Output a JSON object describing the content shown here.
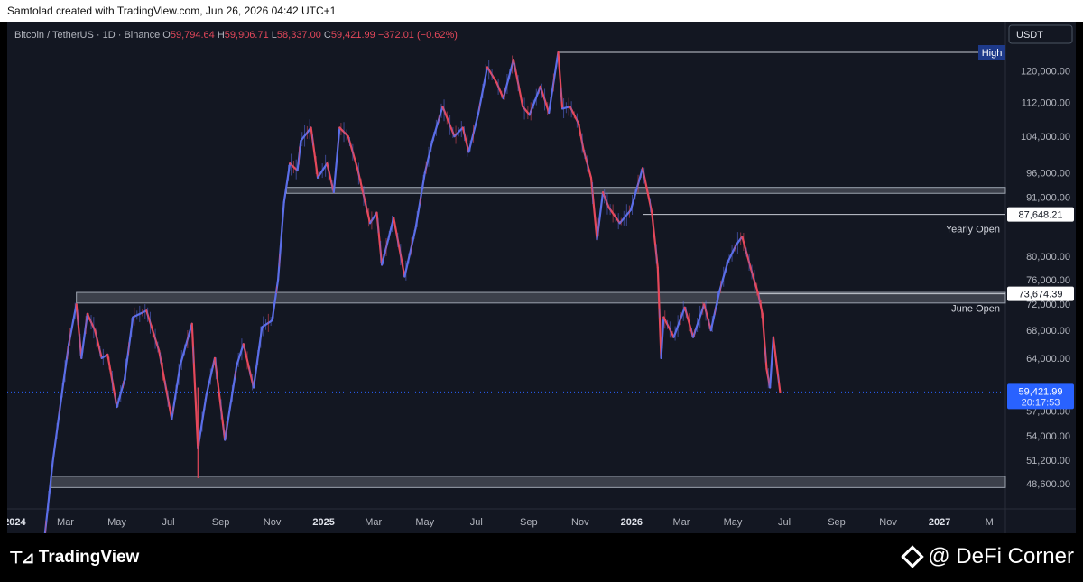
{
  "header": {
    "attribution": "Samtolad created with TradingView.com, Jun 26, 2026 04:42 UTC+1"
  },
  "legend": {
    "symbol": "Bitcoin / TetherUS · 1D · Binance",
    "o_label": "O",
    "o": "59,794.64",
    "h_label": "H",
    "h": "59,906.71",
    "l_label": "L",
    "l": "58,337.00",
    "c_label": "C",
    "c": "59,421.99",
    "change": "−372.01 (−0.62%)"
  },
  "currency": "USDT",
  "footer": {
    "logo": "TradingView",
    "credit": "@ DeFi Corner"
  },
  "colors": {
    "background": "#131722",
    "up": "#5b6ee8",
    "down": "#e5485b",
    "last_price": "#2962ff",
    "high_label": "#1e3a8a"
  },
  "chart_data": {
    "type": "line",
    "y_scale": "log",
    "ylim": [
      46000,
      128000
    ],
    "x_range": [
      "2023-12-23",
      "2027-03-20"
    ],
    "y_ticks": [
      "48,600.00",
      "51,200.00",
      "54,000.00",
      "57,000.00",
      "64,000.00",
      "68,000.00",
      "72,000.00",
      "76,000.00",
      "80,000.00",
      "88,000.00",
      "91,000.00",
      "96,000.00",
      "104,000.00",
      "112,000.00",
      "120,000.00"
    ],
    "x_ticks": [
      {
        "date": "2024-01-01",
        "label": "2024",
        "bold": true
      },
      {
        "date": "2024-03-01",
        "label": "Mar"
      },
      {
        "date": "2024-05-01",
        "label": "May"
      },
      {
        "date": "2024-07-01",
        "label": "Jul"
      },
      {
        "date": "2024-09-01",
        "label": "Sep"
      },
      {
        "date": "2024-11-01",
        "label": "Nov"
      },
      {
        "date": "2025-01-01",
        "label": "2025",
        "bold": true
      },
      {
        "date": "2025-03-01",
        "label": "Mar"
      },
      {
        "date": "2025-05-01",
        "label": "May"
      },
      {
        "date": "2025-07-01",
        "label": "Jul"
      },
      {
        "date": "2025-09-01",
        "label": "Sep"
      },
      {
        "date": "2025-11-01",
        "label": "Nov"
      },
      {
        "date": "2026-01-01",
        "label": "2026",
        "bold": true
      },
      {
        "date": "2026-03-01",
        "label": "Mar"
      },
      {
        "date": "2026-05-01",
        "label": "May"
      },
      {
        "date": "2026-07-01",
        "label": "Jul"
      },
      {
        "date": "2026-09-01",
        "label": "Sep"
      },
      {
        "date": "2026-11-01",
        "label": "Nov"
      },
      {
        "date": "2027-01-01",
        "label": "2027",
        "bold": true
      },
      {
        "date": "2027-03-01",
        "label": "M"
      }
    ],
    "series": [
      {
        "values": [
          [
            "2024-01-01",
            42500
          ],
          [
            "2024-01-20",
            41000
          ],
          [
            "2024-02-05",
            43000
          ],
          [
            "2024-02-15",
            51000
          ],
          [
            "2024-02-28",
            61000
          ],
          [
            "2024-03-05",
            66000
          ],
          [
            "2024-03-14",
            72000
          ],
          [
            "2024-03-20",
            64000
          ],
          [
            "2024-03-27",
            70500
          ],
          [
            "2024-04-05",
            68000
          ],
          [
            "2024-04-13",
            64000
          ],
          [
            "2024-04-20",
            64500
          ],
          [
            "2024-05-01",
            57500
          ],
          [
            "2024-05-10",
            61000
          ],
          [
            "2024-05-20",
            70000
          ],
          [
            "2024-06-05",
            71000
          ],
          [
            "2024-06-20",
            65000
          ],
          [
            "2024-07-05",
            56000
          ],
          [
            "2024-07-15",
            63000
          ],
          [
            "2024-07-29",
            69000
          ],
          [
            "2024-08-05",
            52500
          ],
          [
            "2024-08-15",
            59000
          ],
          [
            "2024-08-25",
            64000
          ],
          [
            "2024-09-06",
            53500
          ],
          [
            "2024-09-20",
            63000
          ],
          [
            "2024-09-28",
            66000
          ],
          [
            "2024-10-10",
            60000
          ],
          [
            "2024-10-20",
            68500
          ],
          [
            "2024-11-01",
            69500
          ],
          [
            "2024-11-08",
            76000
          ],
          [
            "2024-11-15",
            90000
          ],
          [
            "2024-11-22",
            98000
          ],
          [
            "2024-12-01",
            96500
          ],
          [
            "2024-12-05",
            103000
          ],
          [
            "2024-12-17",
            106000
          ],
          [
            "2024-12-25",
            95000
          ],
          [
            "2025-01-05",
            98000
          ],
          [
            "2025-01-13",
            92000
          ],
          [
            "2025-01-20",
            106000
          ],
          [
            "2025-01-30",
            104000
          ],
          [
            "2025-02-10",
            97000
          ],
          [
            "2025-02-25",
            86000
          ],
          [
            "2025-03-05",
            88000
          ],
          [
            "2025-03-11",
            78500
          ],
          [
            "2025-03-25",
            87000
          ],
          [
            "2025-04-07",
            76500
          ],
          [
            "2025-04-20",
            85000
          ],
          [
            "2025-05-01",
            96000
          ],
          [
            "2025-05-10",
            103000
          ],
          [
            "2025-05-22",
            111000
          ],
          [
            "2025-06-05",
            104000
          ],
          [
            "2025-06-15",
            106000
          ],
          [
            "2025-06-22",
            100500
          ],
          [
            "2025-07-03",
            109000
          ],
          [
            "2025-07-14",
            121000
          ],
          [
            "2025-07-25",
            117000
          ],
          [
            "2025-08-02",
            113000
          ],
          [
            "2025-08-14",
            123000
          ],
          [
            "2025-08-25",
            111000
          ],
          [
            "2025-09-02",
            109000
          ],
          [
            "2025-09-15",
            116000
          ],
          [
            "2025-09-25",
            109500
          ],
          [
            "2025-10-06",
            125000
          ],
          [
            "2025-10-11",
            110500
          ],
          [
            "2025-10-20",
            111000
          ],
          [
            "2025-10-30",
            107000
          ],
          [
            "2025-11-05",
            101000
          ],
          [
            "2025-11-14",
            95000
          ],
          [
            "2025-11-21",
            83000
          ],
          [
            "2025-11-28",
            92000
          ],
          [
            "2025-12-05",
            89000
          ],
          [
            "2025-12-18",
            86000
          ],
          [
            "2025-12-31",
            88500
          ],
          [
            "2026-01-14",
            97000
          ],
          [
            "2026-01-25",
            88000
          ],
          [
            "2026-02-01",
            78000
          ],
          [
            "2026-02-05",
            64000
          ],
          [
            "2026-02-08",
            70000
          ],
          [
            "2026-02-20",
            67000
          ],
          [
            "2026-03-05",
            71500
          ],
          [
            "2026-03-15",
            67000
          ],
          [
            "2026-03-28",
            72000
          ],
          [
            "2026-04-05",
            68000
          ],
          [
            "2026-04-15",
            74000
          ],
          [
            "2026-04-25",
            79000
          ],
          [
            "2026-05-05",
            82000
          ],
          [
            "2026-05-12",
            83500
          ],
          [
            "2026-05-22",
            78000
          ],
          [
            "2026-05-31",
            73700
          ],
          [
            "2026-06-05",
            70500
          ],
          [
            "2026-06-10",
            62500
          ],
          [
            "2026-06-14",
            60000
          ],
          [
            "2026-06-18",
            67000
          ],
          [
            "2026-06-22",
            63000
          ],
          [
            "2026-06-26",
            59422
          ]
        ]
      }
    ],
    "zones": [
      {
        "from": 91800,
        "to": 93000
      },
      {
        "from": 72200,
        "to": 73900
      },
      {
        "from": 48200,
        "to": 49400
      }
    ],
    "levels": [
      {
        "name": "High",
        "value": 125000,
        "start": "2025-10-06",
        "box_label": "High"
      },
      {
        "name": "Yearly Open",
        "value": 87648.21,
        "start": "2026-01-14",
        "price_label": "87,648.21",
        "caption": "Yearly Open"
      },
      {
        "name": "June Open",
        "value": 73674.39,
        "start": "2026-06-01",
        "price_label": "73,674.39",
        "caption": "June Open"
      }
    ],
    "support_line": 60600,
    "last_price": {
      "value": 59421.99,
      "label": "59,421.99",
      "countdown": "20:17:53"
    }
  }
}
